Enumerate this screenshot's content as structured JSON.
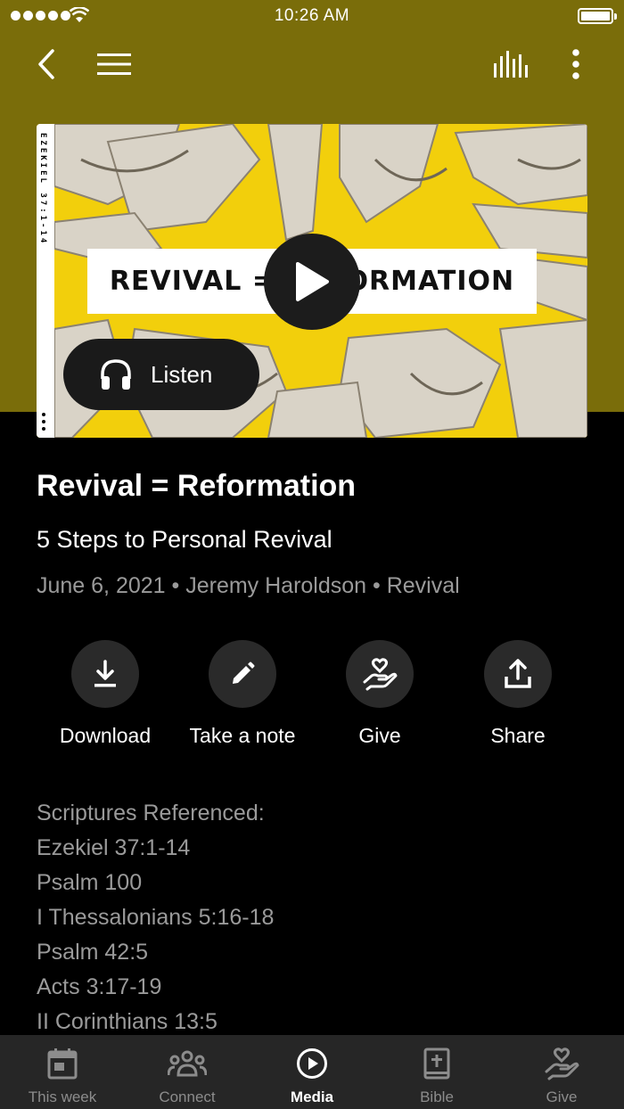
{
  "status_bar": {
    "time": "10:26 AM"
  },
  "colors": {
    "header": "#7a6d0a",
    "hero_yellow": "#f2cf0c",
    "background": "#000000",
    "muted_text": "#9a9a9a",
    "tabbar": "#262626"
  },
  "nav": {
    "icons": [
      "back-icon",
      "menu-icon",
      "equalizer-icon",
      "more-vert-icon"
    ]
  },
  "hero": {
    "side_text": "EZEKIEL 37:1-14",
    "banner_text": "REVIVAL = REFORMATION",
    "listen_label": "Listen"
  },
  "sermon": {
    "title": "Revival = Reformation",
    "subtitle": "5 Steps to Personal Revival",
    "meta": "June 6, 2021 • Jeremy Haroldson • Revival"
  },
  "actions": [
    {
      "label": "Download",
      "icon": "download-icon"
    },
    {
      "label": "Take a note",
      "icon": "pencil-icon"
    },
    {
      "label": "Give",
      "icon": "give-icon"
    },
    {
      "label": "Share",
      "icon": "share-icon"
    }
  ],
  "scriptures": {
    "heading": "Scriptures Referenced:",
    "items": [
      "Ezekiel 37:1-14",
      "Psalm 100",
      "I Thessalonians 5:16-18",
      "Psalm 42:5",
      "Acts 3:17-19",
      "II Corinthians 13:5"
    ]
  },
  "tabs": [
    {
      "label": "This week",
      "icon": "calendar-icon",
      "active": false
    },
    {
      "label": "Connect",
      "icon": "people-icon",
      "active": false
    },
    {
      "label": "Media",
      "icon": "play-circle-icon",
      "active": true
    },
    {
      "label": "Bible",
      "icon": "bible-icon",
      "active": false
    },
    {
      "label": "Give",
      "icon": "give-icon",
      "active": false
    }
  ]
}
